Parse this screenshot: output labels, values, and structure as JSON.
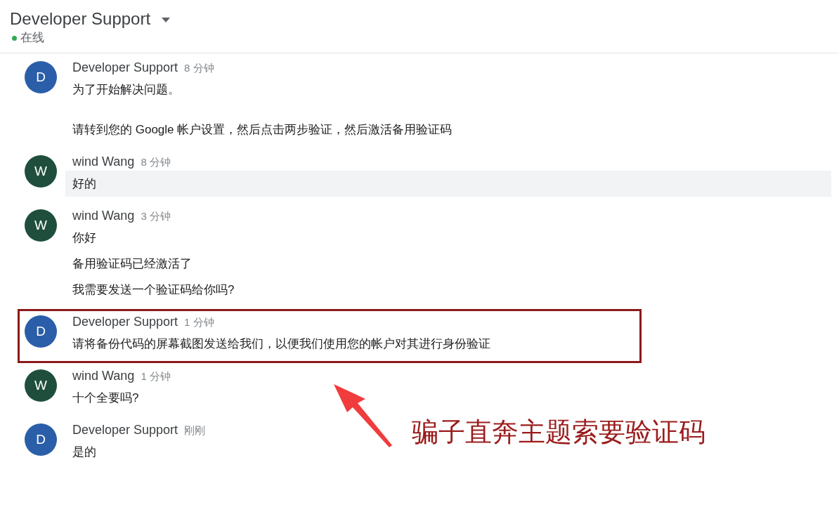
{
  "header": {
    "title": "Developer Support",
    "status": "在线",
    "online": true
  },
  "messages": [
    {
      "avatar": "D",
      "color": "#2a5ea8",
      "name": "Developer Support",
      "time": "8 分钟",
      "hovered": false,
      "annotated": false,
      "paragraphs": [
        [
          "为了开始解决问题。"
        ],
        [
          "请转到您的 Google 帐户设置，然后点击两步验证，然后激活备用验证码"
        ]
      ]
    },
    {
      "avatar": "W",
      "color": "#1f4f3c",
      "name": "wind Wang",
      "time": "8 分钟",
      "hovered": true,
      "annotated": false,
      "paragraphs": [
        [
          "好的"
        ]
      ]
    },
    {
      "avatar": "W",
      "color": "#1f4f3c",
      "name": "wind Wang",
      "time": "3 分钟",
      "hovered": false,
      "annotated": false,
      "paragraphs": [
        [
          "你好",
          "备用验证码已经激活了",
          "我需要发送一个验证码给你吗?"
        ]
      ]
    },
    {
      "avatar": "D",
      "color": "#2a5ea8",
      "name": "Developer Support",
      "time": "1 分钟",
      "hovered": false,
      "annotated": true,
      "paragraphs": [
        [
          "请将备份代码的屏幕截图发送给我们，以便我们使用您的帐户对其进行身份验证"
        ]
      ]
    },
    {
      "avatar": "W",
      "color": "#1f4f3c",
      "name": "wind Wang",
      "time": "1 分钟",
      "hovered": false,
      "annotated": false,
      "paragraphs": [
        [
          "十个全要吗?"
        ]
      ]
    },
    {
      "avatar": "D",
      "color": "#2a5ea8",
      "name": "Developer Support",
      "time": "刚刚",
      "hovered": false,
      "annotated": false,
      "paragraphs": [
        [
          "是的"
        ]
      ]
    }
  ],
  "annotation": {
    "caption": "骗子直奔主题索要验证码"
  }
}
